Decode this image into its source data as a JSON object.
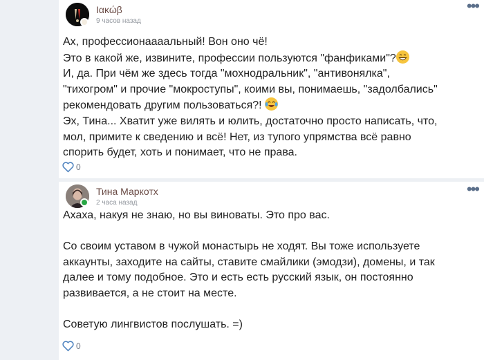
{
  "comments": [
    {
      "author": "Ιακώβ",
      "time": "9 часов назад",
      "line1": "Ах, профессионаааальный! Вон оно чё!",
      "line2": "Это в какой же, извините, профессии пользуются \"фанфиками\"?",
      "emoji1": "grinning-face",
      "line3": "И, да. При чём же здесь тогда \"мохнодральник\", \"антивонялка\",",
      "line4": "\"тихогром\" и прочие \"мокроступы\", коими вы, понимаешь, \"задолбались\"",
      "line5": "рекомендовать другим пользоваться?!",
      "emoji2": "tears-of-joy-face",
      "line6": "Эх, Тина... Хватит уже вилять и юлить, достаточно просто написать, что,",
      "line7": "мол, примите к сведению и всё! Нет, из тупого упрямства всё равно",
      "line8": "спорить будет, хоть и понимает, что не права.",
      "likes": "0"
    },
    {
      "author": "Тина Маркотх",
      "time": "2 часа назад",
      "text": "Ахаха, накуя не знаю, но вы виноваты. Это про вас.\n\nСо своим уставом в чужой монастырь не ходят. Вы тоже используете\nаккаунты, заходите на сайты, ставите смайлики (эмодзи), домены, и так\nдалее и тому подобное. Это и есть есть русский язык, он постоянно\nразвивается, а не стоит на месте.\n\nСоветую лингвистов послушать. =)",
      "likes": "0"
    }
  ],
  "ui": {
    "more_menu_glyph": "•••",
    "accent": "#5b6f8a",
    "online_color": "#28a745"
  }
}
